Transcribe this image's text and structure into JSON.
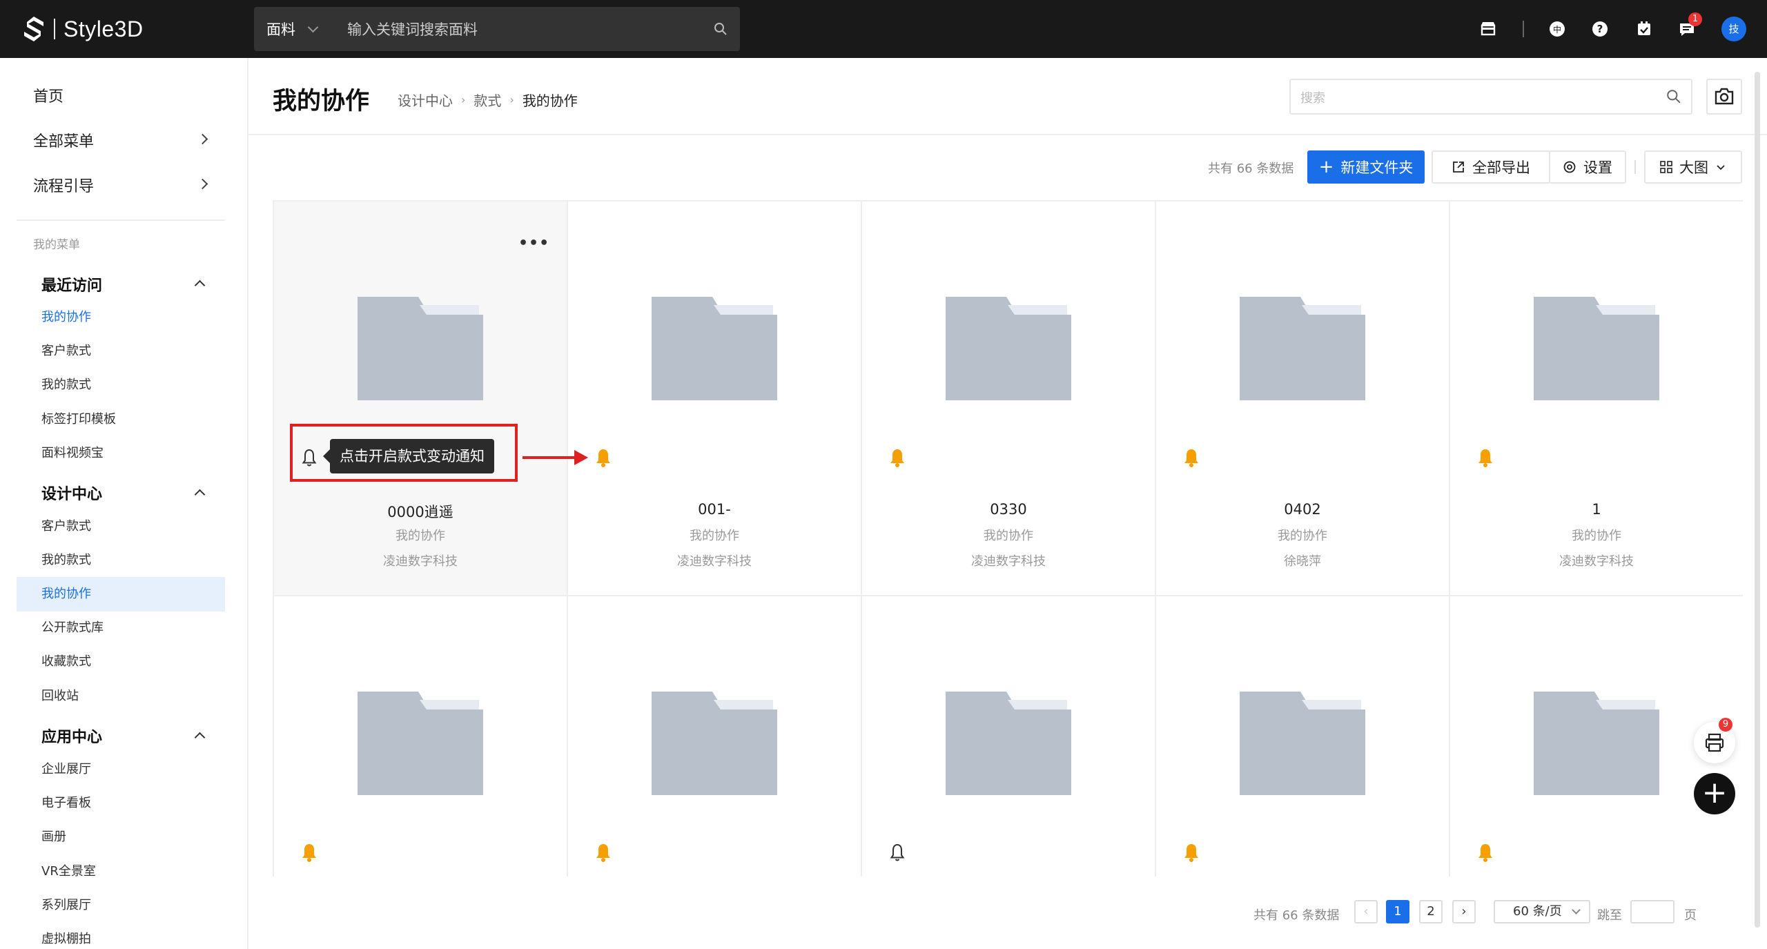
{
  "app": {
    "name": "Style3D"
  },
  "topbar": {
    "search_category": "面料",
    "search_placeholder": "输入关键词搜索面料",
    "message_badge": "1",
    "avatar_text": "技"
  },
  "sidebar": {
    "top_items": [
      {
        "label": "首页"
      },
      {
        "label": "全部菜单"
      },
      {
        "label": "流程引导"
      }
    ],
    "caption": "我的菜单",
    "groups": [
      {
        "title": "最近访问",
        "items": [
          "我的协作",
          "客户款式",
          "我的款式",
          "标签打印模板",
          "面料视频宝"
        ]
      },
      {
        "title": "设计中心",
        "items": [
          "客户款式",
          "我的款式",
          "我的协作",
          "公开款式库",
          "收藏款式",
          "回收站"
        ]
      },
      {
        "title": "应用中心",
        "items": [
          "企业展厅",
          "电子看板",
          "画册",
          "VR全景室",
          "系列展厅",
          "虚拟棚拍"
        ]
      }
    ]
  },
  "header": {
    "title": "我的协作",
    "breadcrumb": [
      "设计中心",
      "款式",
      "我的协作"
    ],
    "search_placeholder": "搜索"
  },
  "toolbar": {
    "total_text": "共有 66 条数据",
    "new_folder": "新建文件夹",
    "export_all": "全部导出",
    "settings": "设置",
    "view_mode": "大图"
  },
  "cards": [
    {
      "name": "0000逍遥",
      "owner": "我的协作",
      "company": "凌迪数字科技",
      "bell": "outline"
    },
    {
      "name": "001-",
      "owner": "我的协作",
      "company": "凌迪数字科技",
      "bell": "filled"
    },
    {
      "name": "0330",
      "owner": "我的协作",
      "company": "凌迪数字科技",
      "bell": "filled"
    },
    {
      "name": "0402",
      "owner": "我的协作",
      "company": "徐晓萍",
      "bell": "filled"
    },
    {
      "name": "1",
      "owner": "我的协作",
      "company": "凌迪数字科技",
      "bell": "filled"
    },
    {
      "bell": "filled"
    },
    {
      "bell": "filled"
    },
    {
      "bell": "outline"
    },
    {
      "bell": "filled"
    },
    {
      "bell": "filled"
    }
  ],
  "tooltip": {
    "text": "点击开启款式变动通知"
  },
  "float": {
    "print_badge": "9"
  },
  "pagination": {
    "total_text": "共有 66 条数据",
    "pages": [
      "1",
      "2"
    ],
    "current_page": "1",
    "page_size": "60 条/页",
    "jump_label": "跳至",
    "jump_suffix": "页"
  },
  "colors": {
    "accent": "#1a6fe8",
    "bell_on": "#f5a000",
    "folder": "#b8c0cc",
    "annotation": "#e02020"
  }
}
